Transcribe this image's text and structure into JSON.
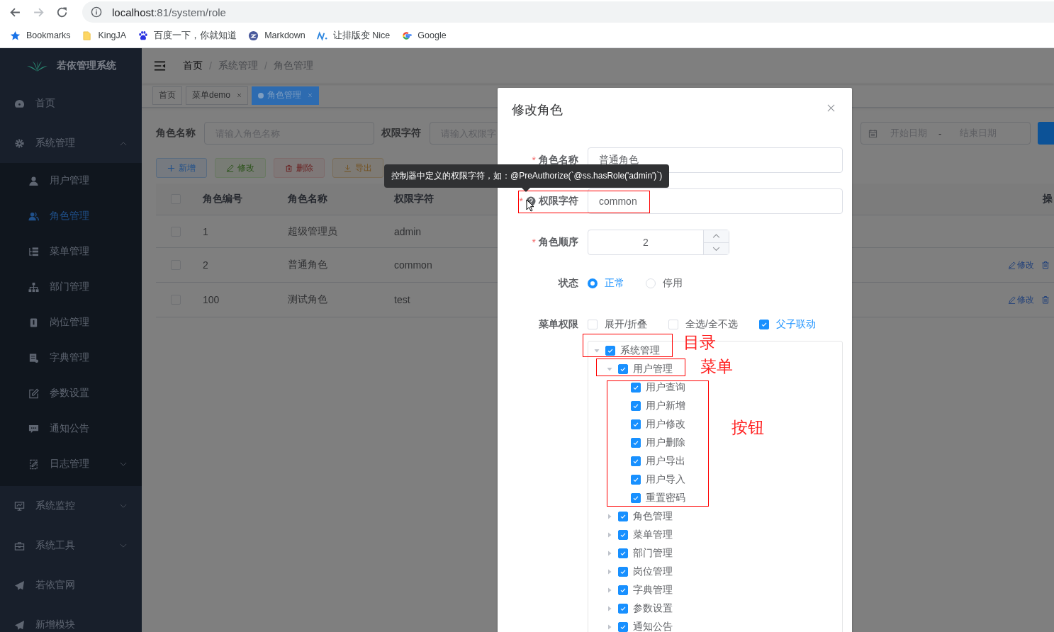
{
  "browser": {
    "url_host": "localhost",
    "url_path": ":81/system/role",
    "bookmarks": [
      {
        "label": "Bookmarks"
      },
      {
        "label": "KingJA"
      },
      {
        "label": "百度一下，你就知道"
      },
      {
        "label": "Markdown"
      },
      {
        "label": "让排版变 Nice"
      },
      {
        "label": "Google"
      }
    ]
  },
  "sidebar": {
    "title": "若依管理系统",
    "items": [
      {
        "label": "首页",
        "selected": false
      },
      {
        "label": "系统管理",
        "selected": false,
        "expanded": true,
        "children": [
          {
            "label": "用户管理",
            "selected": false
          },
          {
            "label": "角色管理",
            "selected": true
          },
          {
            "label": "菜单管理",
            "selected": false
          },
          {
            "label": "部门管理",
            "selected": false
          },
          {
            "label": "岗位管理",
            "selected": false
          },
          {
            "label": "字典管理",
            "selected": false
          },
          {
            "label": "参数设置",
            "selected": false
          },
          {
            "label": "通知公告",
            "selected": false
          },
          {
            "label": "日志管理",
            "selected": false,
            "expanded": false
          }
        ]
      },
      {
        "label": "系统监控",
        "selected": false,
        "expanded": false
      },
      {
        "label": "系统工具",
        "selected": false,
        "expanded": false
      },
      {
        "label": "若依官网",
        "selected": false
      },
      {
        "label": "新增模块",
        "selected": false
      }
    ]
  },
  "navbar": {
    "separator": "/",
    "breadcrumb": [
      "首页",
      "系统管理",
      "角色管理"
    ]
  },
  "tags": [
    {
      "label": "首页",
      "selected": false,
      "closable": false
    },
    {
      "label": "菜单demo",
      "selected": false,
      "closable": true
    },
    {
      "label": "角色管理",
      "selected": true,
      "closable": true
    }
  ],
  "query": {
    "fields": [
      {
        "label": "角色名称",
        "placeholder": "请输入角色名称"
      },
      {
        "label": "权限字符",
        "placeholder": "请输入权限字"
      }
    ],
    "date_range": {
      "start_placeholder": "开始日期",
      "separator": "-",
      "end_placeholder": "结束日期"
    }
  },
  "toolbar": [
    {
      "label": "新增",
      "kind": "primary",
      "disabled": false
    },
    {
      "label": "修改",
      "kind": "success",
      "disabled": true
    },
    {
      "label": "删除",
      "kind": "danger",
      "disabled": true
    },
    {
      "label": "导出",
      "kind": "warning",
      "disabled": false
    }
  ],
  "table": {
    "header_checked": false,
    "columns": [
      "角色编号",
      "角色名称",
      "权限字符",
      "操"
    ],
    "rows": [
      {
        "checked": false,
        "cells": [
          "1",
          "超级管理员",
          "admin"
        ]
      },
      {
        "checked": false,
        "cells": [
          "2",
          "普通角色",
          "common"
        ],
        "actions": [
          "修改"
        ]
      },
      {
        "checked": false,
        "cells": [
          "100",
          "测试角色",
          "test"
        ],
        "actions": [
          "修改"
        ]
      }
    ]
  },
  "dialog": {
    "title": "修改角色",
    "required_mark": "*",
    "fields": [
      {
        "kind": "text",
        "label": "角色名称",
        "required": true,
        "value": "普通角色"
      },
      {
        "kind": "text",
        "label": "权限字符",
        "required": true,
        "help": true,
        "value": "common"
      },
      {
        "kind": "number",
        "label": "角色顺序",
        "required": true,
        "value": "2"
      },
      {
        "kind": "radio",
        "label": "状态",
        "required": false,
        "options": [
          {
            "label": "正常",
            "selected": true
          },
          {
            "label": "停用",
            "selected": false
          }
        ]
      },
      {
        "kind": "tree",
        "label": "菜单权限",
        "required": false,
        "options": [
          {
            "label": "展开/折叠",
            "checked": false
          },
          {
            "label": "全选/全不选",
            "checked": false
          },
          {
            "label": "父子联动",
            "checked": true
          }
        ],
        "tree": [
          {
            "label": "系统管理",
            "checked": true,
            "expanded": true,
            "children": [
              {
                "label": "用户管理",
                "checked": true,
                "expanded": true,
                "children": [
                  {
                    "label": "用户查询",
                    "checked": true
                  },
                  {
                    "label": "用户新增",
                    "checked": true
                  },
                  {
                    "label": "用户修改",
                    "checked": true
                  },
                  {
                    "label": "用户删除",
                    "checked": true
                  },
                  {
                    "label": "用户导出",
                    "checked": true
                  },
                  {
                    "label": "用户导入",
                    "checked": true
                  },
                  {
                    "label": "重置密码",
                    "checked": true
                  }
                ]
              },
              {
                "label": "角色管理",
                "checked": true,
                "expanded": false
              },
              {
                "label": "菜单管理",
                "checked": true,
                "expanded": false
              },
              {
                "label": "部门管理",
                "checked": true,
                "expanded": false
              },
              {
                "label": "岗位管理",
                "checked": true,
                "expanded": false
              },
              {
                "label": "字典管理",
                "checked": true,
                "expanded": false
              },
              {
                "label": "参数设置",
                "checked": true,
                "expanded": false
              },
              {
                "label": "通知公告",
                "checked": true,
                "expanded": false
              }
            ]
          }
        ]
      }
    ]
  },
  "tooltip": "控制器中定义的权限字符，如：@PreAuthorize(`@ss.hasRole('admin')`)",
  "annotations": [
    {
      "kind": "box"
    },
    {
      "kind": "box",
      "label": "目录"
    },
    {
      "kind": "box",
      "label": "菜单"
    },
    {
      "kind": "box",
      "label": "按钮"
    }
  ]
}
